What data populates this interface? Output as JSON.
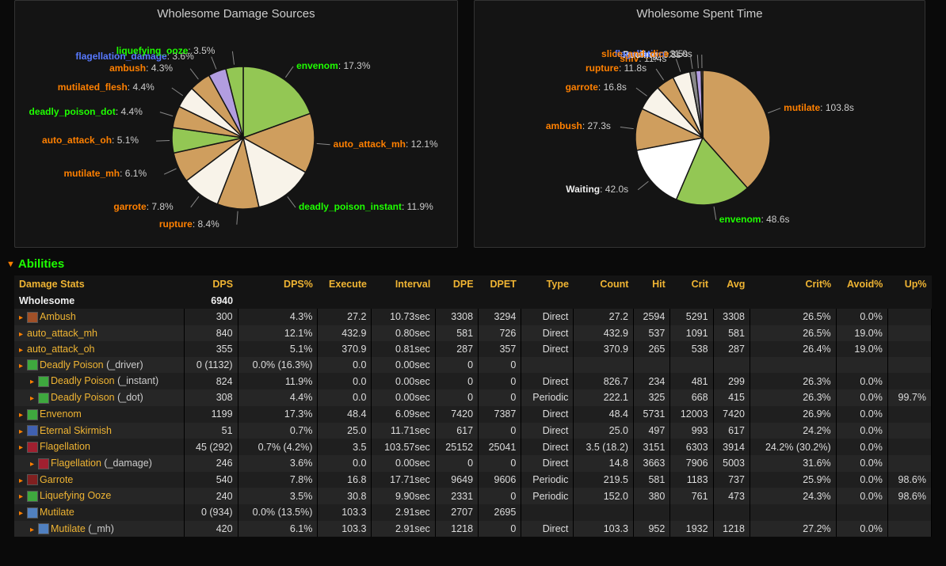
{
  "chart_data": [
    {
      "type": "pie",
      "title": "Wholesome Damage Sources",
      "series": [
        {
          "name": "envenom",
          "value": 17.3,
          "color": "#93c754",
          "label_color": "green"
        },
        {
          "name": "auto_attack_mh",
          "value": 12.1,
          "color": "#cf9e5e",
          "label_color": "orange"
        },
        {
          "name": "deadly_poison_instant",
          "value": 11.9,
          "color": "#f8f3e9",
          "label_color": "green"
        },
        {
          "name": "rupture",
          "value": 8.4,
          "color": "#cf9e5e",
          "label_color": "orange"
        },
        {
          "name": "garrote",
          "value": 7.8,
          "color": "#f8f3e9",
          "label_color": "orange"
        },
        {
          "name": "mutilate_mh",
          "value": 6.1,
          "color": "#cf9e5e",
          "label_color": "orange"
        },
        {
          "name": "auto_attack_oh",
          "value": 5.1,
          "color": "#93c754",
          "label_color": "orange"
        },
        {
          "name": "deadly_poison_dot",
          "value": 4.4,
          "color": "#cf9e5e",
          "label_color": "green"
        },
        {
          "name": "mutilated_flesh",
          "value": 4.4,
          "color": "#f8f3e9",
          "label_color": "orange"
        },
        {
          "name": "ambush",
          "value": 4.3,
          "color": "#cf9e5e",
          "label_color": "orange"
        },
        {
          "name": "flagellation_damage",
          "value": 3.6,
          "color": "#b29de0",
          "label_color": "blue"
        },
        {
          "name": "liquefying_ooze",
          "value": 3.5,
          "color": "#93c754",
          "label_color": "green"
        }
      ]
    },
    {
      "type": "pie",
      "title": "Wholesome Spent Time",
      "series": [
        {
          "name": "mutilate",
          "value": 103.8,
          "unit": "s",
          "color": "#cf9e5e",
          "label_color": "orange"
        },
        {
          "name": "envenom",
          "value": 48.6,
          "unit": "s",
          "color": "#93c754",
          "label_color": "green"
        },
        {
          "name": "Waiting",
          "value": 42.0,
          "unit": "s",
          "color": "#ffffff",
          "label_color": "white"
        },
        {
          "name": "ambush",
          "value": 27.3,
          "unit": "s",
          "color": "#cf9e5e",
          "label_color": "orange"
        },
        {
          "name": "garrote",
          "value": 16.8,
          "unit": "s",
          "color": "#f8f3e9",
          "label_color": "orange"
        },
        {
          "name": "rupture",
          "value": 11.8,
          "unit": "s",
          "color": "#cf9e5e",
          "label_color": "orange"
        },
        {
          "name": "shiv",
          "value": 11.4,
          "unit": "s",
          "color": "#f8f3e9",
          "label_color": "orange"
        },
        {
          "name": "Pooling",
          "value": 3.8,
          "unit": "s",
          "color": "#888888",
          "label_color": "white"
        },
        {
          "name": "flagellation",
          "value": 3.5,
          "unit": "s",
          "color": "#b29de0",
          "label_color": "blue"
        },
        {
          "name": "slice_and_dice",
          "value": 1.0,
          "unit": "s",
          "color": "#cf9e5e",
          "label_color": "orange"
        }
      ]
    }
  ],
  "section": {
    "abilities": "Abilities"
  },
  "table": {
    "headers": [
      "Damage Stats",
      "DPS",
      "DPS%",
      "Execute",
      "Interval",
      "DPE",
      "DPET",
      "Type",
      "Count",
      "Hit",
      "Crit",
      "Avg",
      "Crit%",
      "Avoid%",
      "Up%"
    ],
    "group_row": {
      "name": "Wholesome",
      "dps": "6940"
    },
    "rows": [
      {
        "indent": 0,
        "icon": "#a05028",
        "name": "Ambush",
        "sub": "",
        "dps": "300",
        "dpsp": "4.3%",
        "exe": "27.2",
        "intv": "10.73sec",
        "dpe": "3308",
        "dpet": "3294",
        "type": "Direct",
        "count": "27.2",
        "hit": "2594",
        "crit": "5291",
        "avg": "3308",
        "critp": "26.5%",
        "avoidp": "0.0%",
        "upp": ""
      },
      {
        "indent": 0,
        "icon": "",
        "name": "auto_attack_mh",
        "sub": "",
        "dps": "840",
        "dpsp": "12.1%",
        "exe": "432.9",
        "intv": "0.80sec",
        "dpe": "581",
        "dpet": "726",
        "type": "Direct",
        "count": "432.9",
        "hit": "537",
        "crit": "1091",
        "avg": "581",
        "critp": "26.5%",
        "avoidp": "19.0%",
        "upp": ""
      },
      {
        "indent": 0,
        "icon": "",
        "name": "auto_attack_oh",
        "sub": "",
        "dps": "355",
        "dpsp": "5.1%",
        "exe": "370.9",
        "intv": "0.81sec",
        "dpe": "287",
        "dpet": "357",
        "type": "Direct",
        "count": "370.9",
        "hit": "265",
        "crit": "538",
        "avg": "287",
        "critp": "26.4%",
        "avoidp": "19.0%",
        "upp": ""
      },
      {
        "indent": 0,
        "icon": "#3ea83e",
        "name": "Deadly Poison",
        "sub": " (_driver)",
        "dps": "0 (1132)",
        "dpsp": "0.0% (16.3%)",
        "exe": "0.0",
        "intv": "0.00sec",
        "dpe": "0",
        "dpet": "0",
        "type": "",
        "count": "",
        "hit": "",
        "crit": "",
        "avg": "",
        "critp": "",
        "avoidp": "",
        "upp": ""
      },
      {
        "indent": 1,
        "icon": "#3ea83e",
        "name": "Deadly Poison",
        "sub": " (_instant)",
        "dps": "824",
        "dpsp": "11.9%",
        "exe": "0.0",
        "intv": "0.00sec",
        "dpe": "0",
        "dpet": "0",
        "type": "Direct",
        "count": "826.7",
        "hit": "234",
        "crit": "481",
        "avg": "299",
        "critp": "26.3%",
        "avoidp": "0.0%",
        "upp": ""
      },
      {
        "indent": 1,
        "icon": "#3ea83e",
        "name": "Deadly Poison",
        "sub": " (_dot)",
        "dps": "308",
        "dpsp": "4.4%",
        "exe": "0.0",
        "intv": "0.00sec",
        "dpe": "0",
        "dpet": "0",
        "type": "Periodic",
        "count": "222.1",
        "hit": "325",
        "crit": "668",
        "avg": "415",
        "critp": "26.3%",
        "avoidp": "0.0%",
        "upp": "99.7%"
      },
      {
        "indent": 0,
        "icon": "#3ea83e",
        "name": "Envenom",
        "sub": "",
        "dps": "1199",
        "dpsp": "17.3%",
        "exe": "48.4",
        "intv": "6.09sec",
        "dpe": "7420",
        "dpet": "7387",
        "type": "Direct",
        "count": "48.4",
        "hit": "5731",
        "crit": "12003",
        "avg": "7420",
        "critp": "26.9%",
        "avoidp": "0.0%",
        "upp": ""
      },
      {
        "indent": 0,
        "icon": "#4060b0",
        "name": "Eternal Skirmish",
        "sub": "",
        "dps": "51",
        "dpsp": "0.7%",
        "exe": "25.0",
        "intv": "11.71sec",
        "dpe": "617",
        "dpet": "0",
        "type": "Direct",
        "count": "25.0",
        "hit": "497",
        "crit": "993",
        "avg": "617",
        "critp": "24.2%",
        "avoidp": "0.0%",
        "upp": ""
      },
      {
        "indent": 0,
        "icon": "#a02030",
        "name": "Flagellation",
        "sub": "",
        "dps": "45 (292)",
        "dpsp": "0.7% (4.2%)",
        "exe": "3.5",
        "intv": "103.57sec",
        "dpe": "25152",
        "dpet": "25041",
        "type": "Direct",
        "count": "3.5 (18.2)",
        "hit": "3151",
        "crit": "6303",
        "avg": "3914",
        "critp": "24.2% (30.2%)",
        "avoidp": "0.0%",
        "upp": ""
      },
      {
        "indent": 1,
        "icon": "#a02030",
        "name": "Flagellation",
        "sub": " (_damage)",
        "dps": "246",
        "dpsp": "3.6%",
        "exe": "0.0",
        "intv": "0.00sec",
        "dpe": "0",
        "dpet": "0",
        "type": "Direct",
        "count": "14.8",
        "hit": "3663",
        "crit": "7906",
        "avg": "5003",
        "critp": "31.6%",
        "avoidp": "0.0%",
        "upp": ""
      },
      {
        "indent": 0,
        "icon": "#802020",
        "name": "Garrote",
        "sub": "",
        "dps": "540",
        "dpsp": "7.8%",
        "exe": "16.8",
        "intv": "17.71sec",
        "dpe": "9649",
        "dpet": "9606",
        "type": "Periodic",
        "count": "219.5",
        "hit": "581",
        "crit": "1183",
        "avg": "737",
        "critp": "25.9%",
        "avoidp": "0.0%",
        "upp": "98.6%"
      },
      {
        "indent": 0,
        "icon": "#3ea83e",
        "name": "Liquefying Ooze",
        "sub": "",
        "dps": "240",
        "dpsp": "3.5%",
        "exe": "30.8",
        "intv": "9.90sec",
        "dpe": "2331",
        "dpet": "0",
        "type": "Periodic",
        "count": "152.0",
        "hit": "380",
        "crit": "761",
        "avg": "473",
        "critp": "24.3%",
        "avoidp": "0.0%",
        "upp": "98.6%"
      },
      {
        "indent": 0,
        "icon": "#5080c0",
        "name": "Mutilate",
        "sub": "",
        "dps": "0 (934)",
        "dpsp": "0.0% (13.5%)",
        "exe": "103.3",
        "intv": "2.91sec",
        "dpe": "2707",
        "dpet": "2695",
        "type": "",
        "count": "",
        "hit": "",
        "crit": "",
        "avg": "",
        "critp": "",
        "avoidp": "",
        "upp": ""
      },
      {
        "indent": 1,
        "icon": "#5080c0",
        "name": "Mutilate",
        "sub": " (_mh)",
        "dps": "420",
        "dpsp": "6.1%",
        "exe": "103.3",
        "intv": "2.91sec",
        "dpe": "1218",
        "dpet": "0",
        "type": "Direct",
        "count": "103.3",
        "hit": "952",
        "crit": "1932",
        "avg": "1218",
        "critp": "27.2%",
        "avoidp": "0.0%",
        "upp": ""
      }
    ]
  }
}
